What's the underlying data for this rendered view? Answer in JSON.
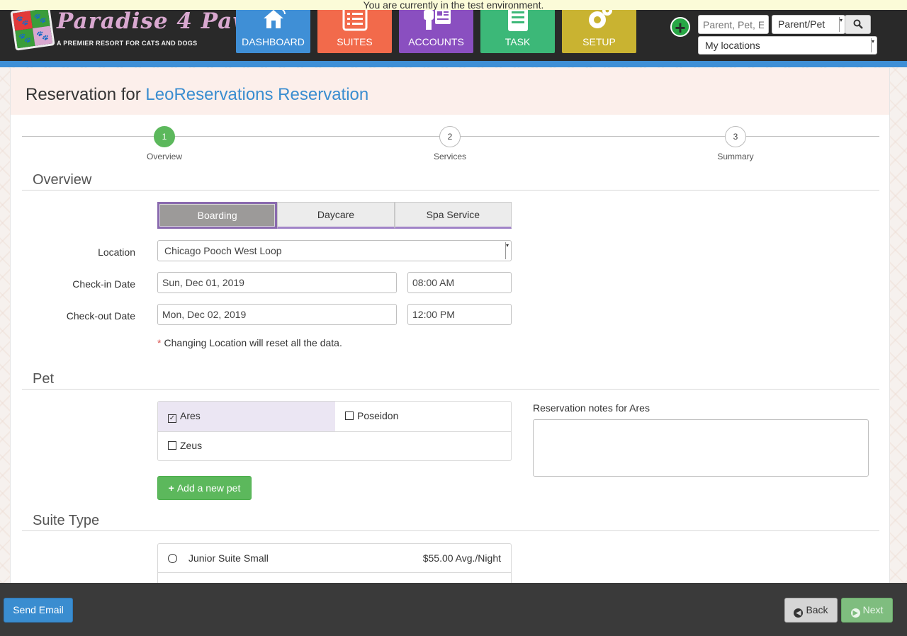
{
  "banner": {
    "text": "You are currently in the test environment."
  },
  "brand": {
    "title": "Paradise 4 Paws",
    "subtitle": "A PREMIER RESORT FOR CATS AND DOGS"
  },
  "nav": [
    {
      "label": "DASHBOARD",
      "color": "#3f8fd6",
      "icon": "house-icon"
    },
    {
      "label": "SUITES",
      "color": "#f26a4b",
      "icon": "list-icon"
    },
    {
      "label": "ACCOUNTS",
      "color": "#8a4fc0",
      "icon": "id-card-icon"
    },
    {
      "label": "TASK",
      "color": "#3cb878",
      "icon": "document-icon"
    },
    {
      "label": "SETUP",
      "color": "#c9b331",
      "icon": "gear-icon"
    }
  ],
  "header_search": {
    "placeholder": "Parent, Pet, E",
    "type_value": "Parent/Pet",
    "location_value": "My locations"
  },
  "page": {
    "title_prefix": "Reservation for ",
    "title_link": "LeoReservations Reservation"
  },
  "wizard": [
    {
      "number": "1",
      "label": "Overview",
      "active": true
    },
    {
      "number": "2",
      "label": "Services",
      "active": false
    },
    {
      "number": "3",
      "label": "Summary",
      "active": false
    }
  ],
  "overview": {
    "heading": "Overview",
    "service_types": [
      "Boarding",
      "Daycare",
      "Spa Service"
    ],
    "selected_type": "Boarding",
    "location_label": "Location",
    "location_value": "Chicago Pooch West Loop",
    "checkin_label": "Check-in Date",
    "checkin_date": "Sun, Dec 01, 2019",
    "checkin_time": "08:00 AM",
    "checkout_label": "Check-out Date",
    "checkout_date": "Mon, Dec 02, 2019",
    "checkout_time": "12:00 PM",
    "note_star": "*",
    "note": "Changing Location will reset all the data."
  },
  "pet": {
    "heading": "Pet",
    "pets": [
      {
        "name": "Ares",
        "checked": true
      },
      {
        "name": "Poseidon",
        "checked": false
      },
      {
        "name": "Zeus",
        "checked": false
      }
    ],
    "notes_label": "Reservation notes for Ares",
    "add_label": "Add a new pet"
  },
  "suite_type": {
    "heading": "Suite Type",
    "options": [
      {
        "name": "Junior Suite Small",
        "price": "$55.00 Avg./Night",
        "selected": false
      }
    ]
  },
  "footer": {
    "email_label": "Send Email",
    "back_label": "Back",
    "next_label": "Next"
  }
}
